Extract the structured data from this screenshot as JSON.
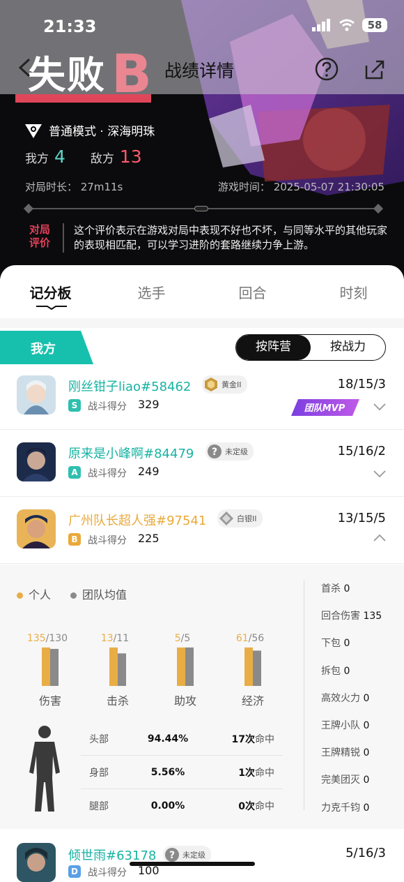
{
  "status": {
    "time": "21:33",
    "battery": "58"
  },
  "header": {
    "result": "失败",
    "grade": "B",
    "title": "战绩详情"
  },
  "match": {
    "mode": "普通模式 · 深海明珠",
    "our_label": "我方",
    "our_score": "4",
    "enemy_label": "敌方",
    "enemy_score": "13",
    "duration": "对局时长： 27m11s",
    "game_time": "游戏时间： 2025-05-07 21:30:05"
  },
  "evaluation": {
    "label_top": "对局",
    "label_bottom": "评价",
    "text": "这个评价表示在游戏对局中表现不好也不坏，与同等水平的其他玩家的表现相匹配，可以学习进阶的套路继续力争上游。"
  },
  "tabs": [
    "记分板",
    "选手",
    "回合",
    "时刻"
  ],
  "team": {
    "label": "我方",
    "sort_camp": "按阵营",
    "sort_power": "按战力"
  },
  "score_label": "战斗得分",
  "players": [
    {
      "name": "刚丝钳子liao#58462",
      "rank": "黄金II",
      "grade": "S",
      "grade_color": "#2fbfae",
      "score": "329",
      "kda": "18/15/3",
      "mvp": "团队MVP"
    },
    {
      "name": "原来是小峰啊#84479",
      "rank": "未定级",
      "grade": "A",
      "grade_color": "#2fbfae",
      "score": "249",
      "kda": "15/16/2"
    },
    {
      "name": "广州队长超人强#97541",
      "rank": "白银II",
      "grade": "B",
      "grade_color": "#e9a93a",
      "score": "225",
      "kda": "13/15/5"
    },
    {
      "name": "倾世雨#63178",
      "rank": "未定级",
      "grade": "D",
      "grade_color": "#5aa0e6",
      "score": "100",
      "kda": "5/16/3"
    }
  ],
  "detail": {
    "legend_personal": "个人",
    "legend_team": "团队均值",
    "bars": [
      {
        "label": "伤害",
        "personal": "135",
        "team": "/130",
        "pv": 135,
        "tv": 130
      },
      {
        "label": "击杀",
        "personal": "13",
        "team": "/11",
        "pv": 13,
        "tv": 11
      },
      {
        "label": "助攻",
        "personal": "5",
        "team": "/5",
        "pv": 5,
        "tv": 5
      },
      {
        "label": "经济",
        "personal": "61",
        "team": "/56",
        "pv": 61,
        "tv": 56
      }
    ],
    "hits": [
      {
        "part": "头部",
        "pct": "94.44%",
        "count": "17",
        "unit_a": "次",
        "unit_b": "命中"
      },
      {
        "part": "身部",
        "pct": "5.56%",
        "count": "1",
        "unit_a": "次",
        "unit_b": "命中"
      },
      {
        "part": "腿部",
        "pct": "0.00%",
        "count": "0",
        "unit_a": "次",
        "unit_b": "命中"
      }
    ],
    "stats": [
      {
        "label": "首杀",
        "value": "0"
      },
      {
        "label": "回合伤害",
        "value": "135"
      },
      {
        "label": "下包",
        "value": "0"
      },
      {
        "label": "拆包",
        "value": "0"
      },
      {
        "label": "高效火力",
        "value": "0"
      },
      {
        "label": "王牌小队",
        "value": "0"
      },
      {
        "label": "王牌精锐",
        "value": "0"
      },
      {
        "label": "完美团灭",
        "value": "0"
      },
      {
        "label": "力克千钧",
        "value": "0"
      }
    ]
  },
  "colors": {
    "accent": "#17c0ad",
    "personal": "#e9ad45",
    "team": "#8a8a8a",
    "loss": "#e4405a"
  }
}
